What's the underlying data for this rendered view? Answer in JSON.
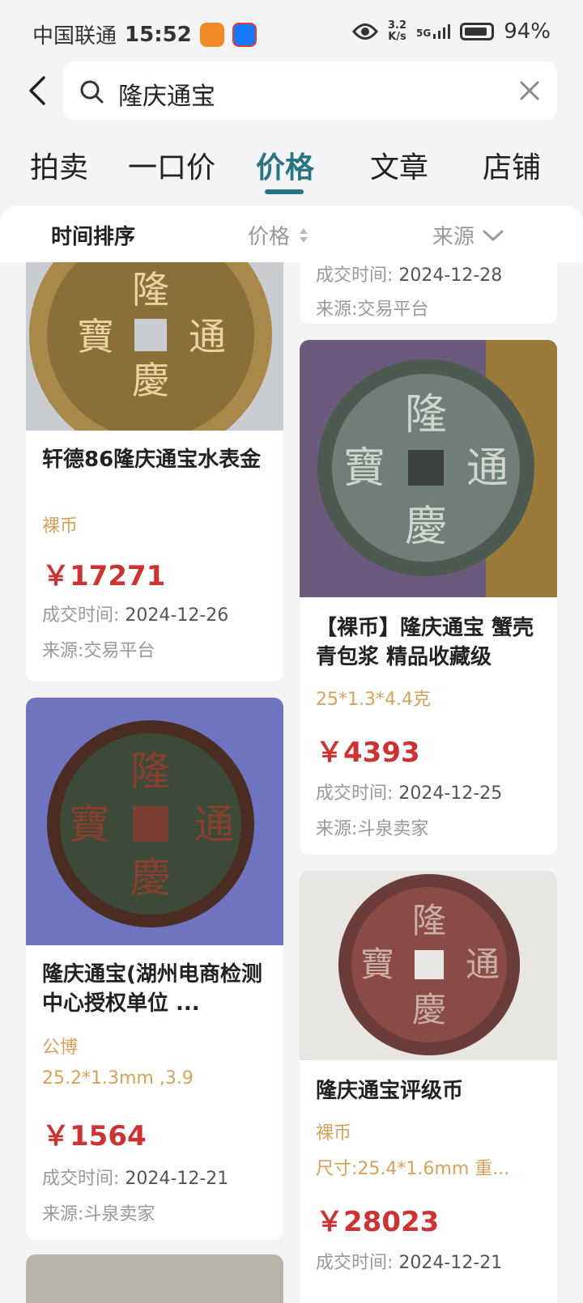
{
  "status": {
    "carrier": "中国联通",
    "time": "15:52",
    "speed_top": "3.2",
    "speed_unit": "K/s",
    "network": "5G",
    "battery": "94%"
  },
  "search": {
    "query": "隆庆通宝"
  },
  "tabs": [
    "拍卖",
    "一口价",
    "价格",
    "文章",
    "店铺"
  ],
  "active_tab": 2,
  "sort": {
    "time": "时间排序",
    "price": "价格",
    "source": "来源"
  },
  "labels": {
    "deal_time": "成交时间:",
    "source": "来源:"
  },
  "cards": {
    "c0": {
      "title": "轩德86隆庆通宝水表金",
      "tag": "裸币",
      "price": "￥17271",
      "date": "2024-12-26",
      "source": "交易平台"
    },
    "c1": {
      "title": "隆庆通宝(湖州电商检测中心授权单位 ...",
      "tag": "公博",
      "spec": "25.2*1.3mm ,3.9",
      "price": "￥1564",
      "date": "2024-12-21",
      "source": "斗泉卖家"
    },
    "r0": {
      "date": "2024-12-28",
      "source": "交易平台"
    },
    "r1": {
      "title": "【裸币】隆庆通宝 蟹壳青包浆 精品收藏级",
      "spec": "25*1.3*4.4克",
      "price": "￥4393",
      "date": "2024-12-25",
      "source": "斗泉卖家"
    },
    "r2": {
      "title": "隆庆通宝评级币",
      "tag": "裸币",
      "spec": "尺寸:25.4*1.6mm 重...",
      "price": "￥28023",
      "date": "2024-12-21"
    }
  },
  "coin_chars": {
    "top": "隆",
    "right": "通",
    "bottom": "慶",
    "left": "寶"
  },
  "colors": {
    "accent": "#2a7480",
    "price": "#cc3333",
    "tag": "#d6a25b"
  }
}
